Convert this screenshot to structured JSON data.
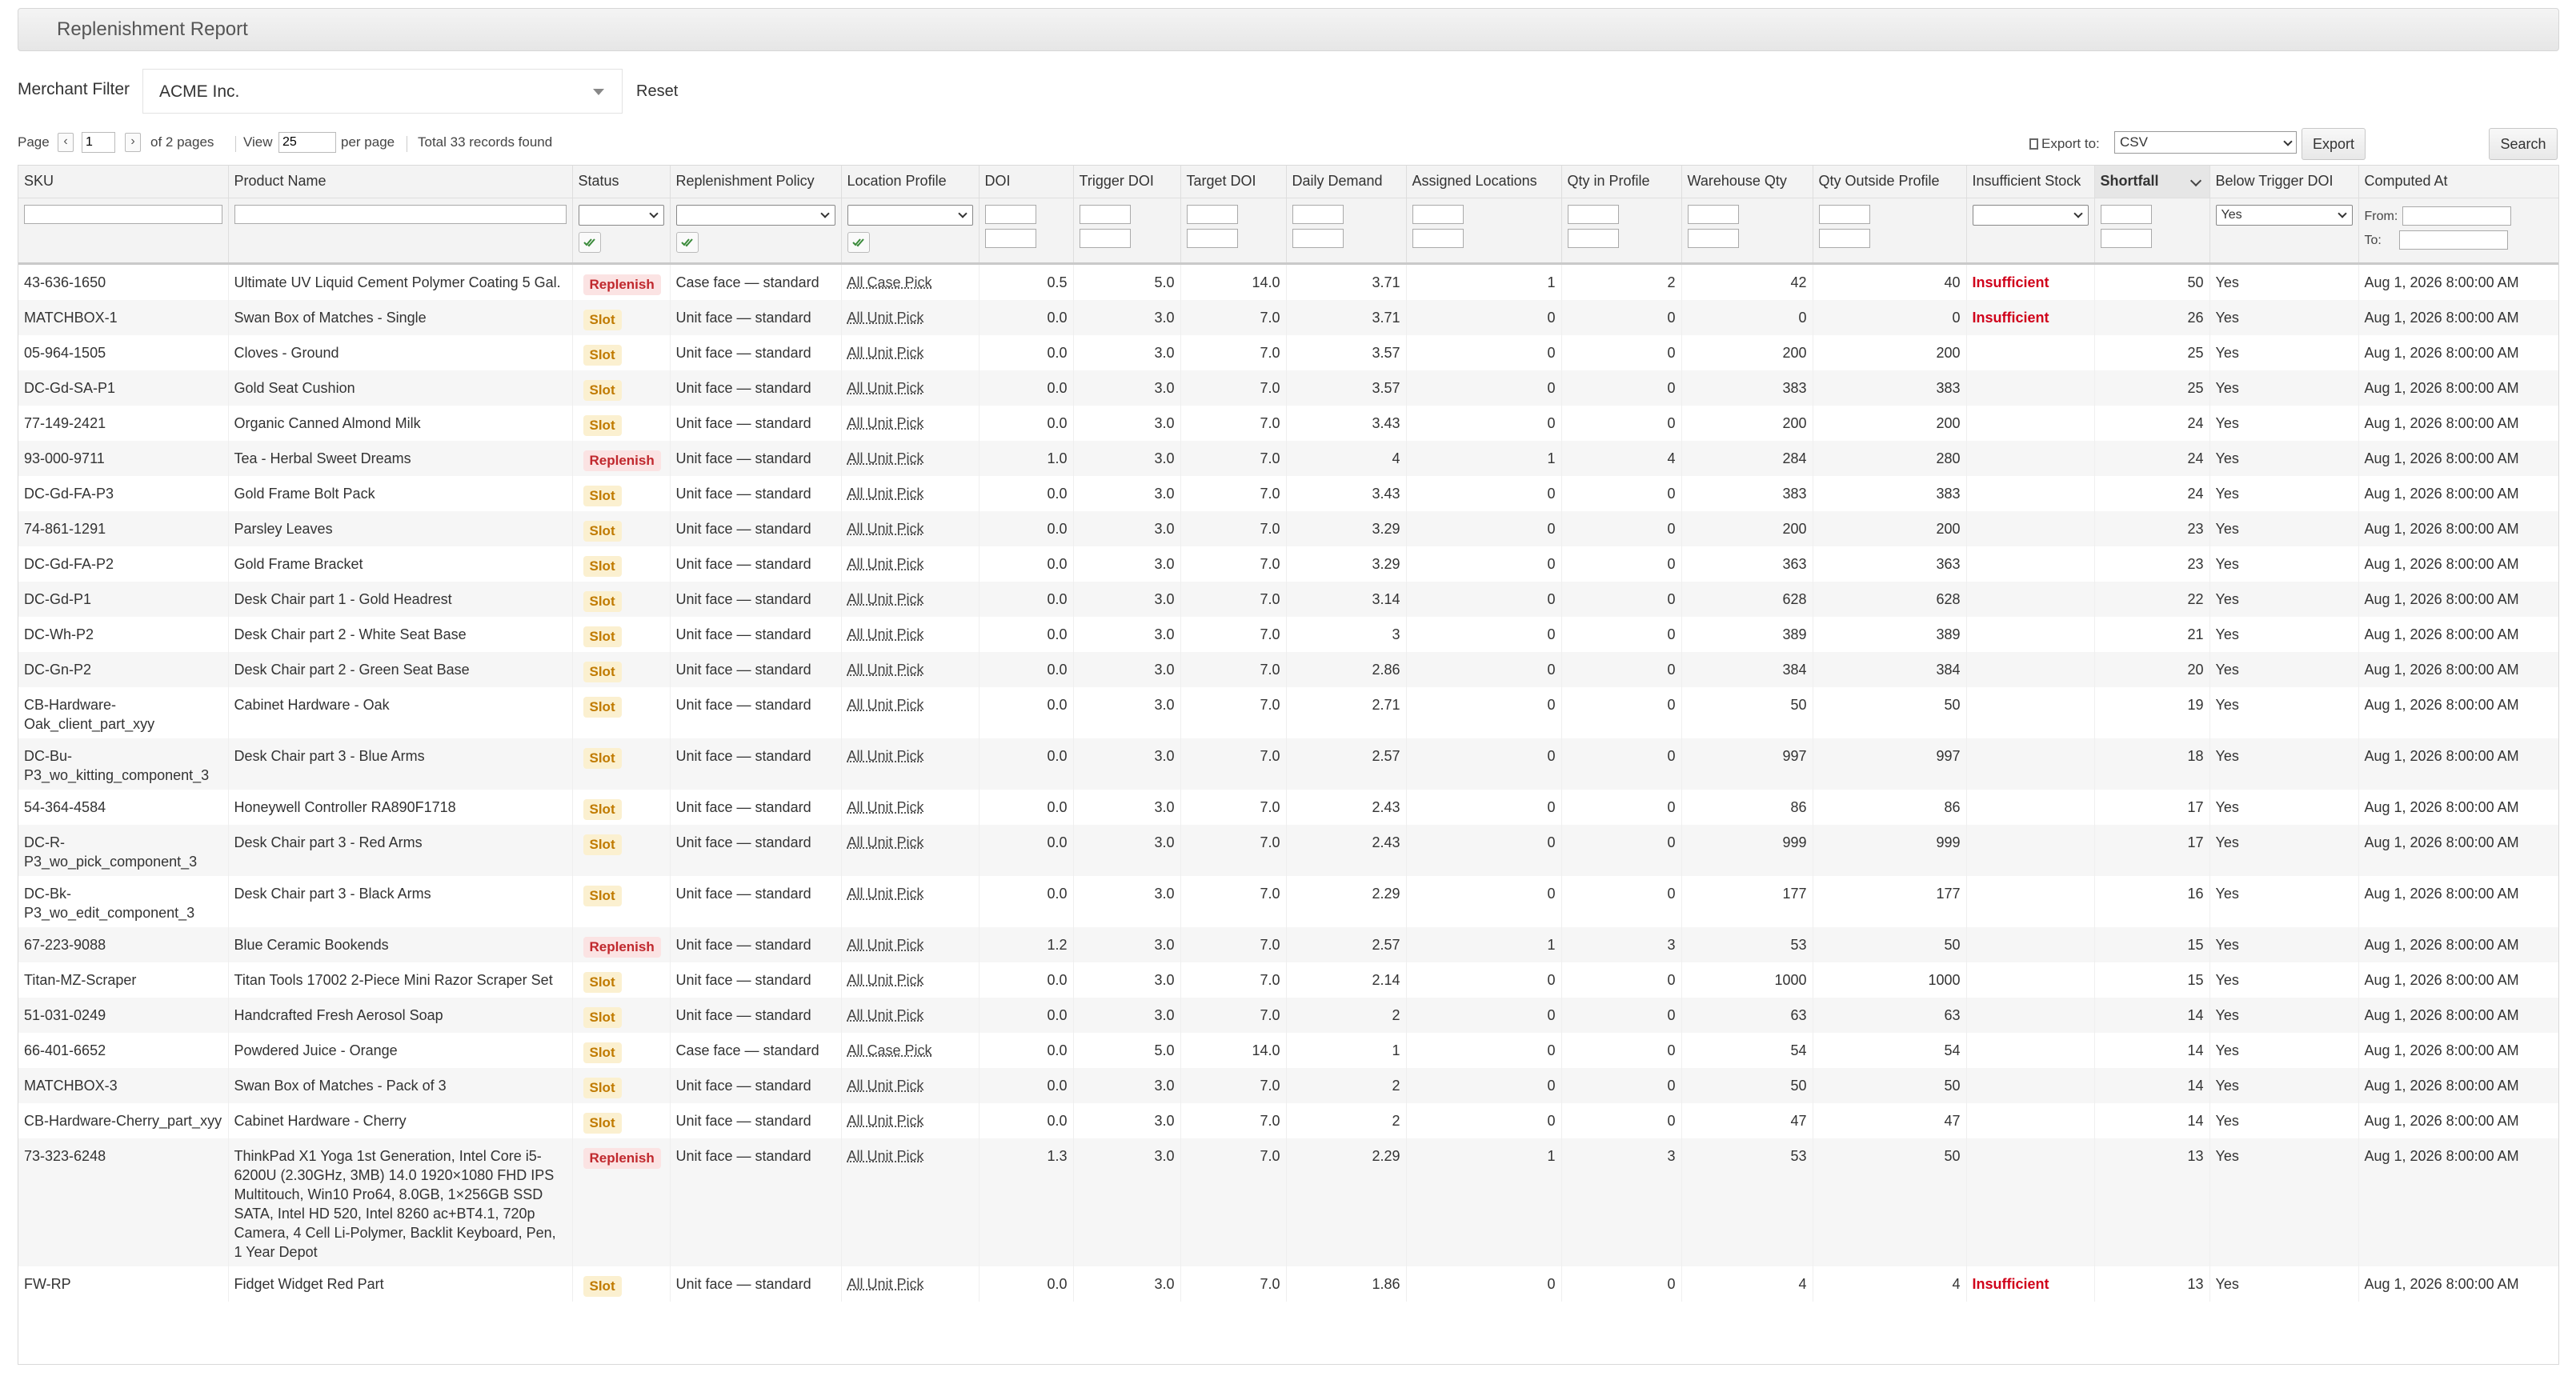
{
  "header": {
    "title": "Replenishment Report"
  },
  "merchant": {
    "label": "Merchant Filter",
    "value": "ACME Inc.",
    "reset": "Reset"
  },
  "pager": {
    "page_label": "Page",
    "page": "1",
    "of_pages": "of 2 pages",
    "view_label": "View",
    "per_page": "25",
    "per_page_label": "per page",
    "total": "Total 33 records found"
  },
  "export": {
    "label": "Export to:",
    "format": "CSV",
    "button": "Export"
  },
  "search_button": "Search",
  "columns": [
    "SKU",
    "Product Name",
    "Status",
    "Replenishment Policy",
    "Location Profile",
    "DOI",
    "Trigger DOI",
    "Target DOI",
    "Daily Demand",
    "Assigned Locations",
    "Qty in Profile",
    "Warehouse Qty",
    "Qty Outside Profile",
    "Insufficient Stock",
    "Shortfall",
    "Below Trigger DOI",
    "Computed At"
  ],
  "filters": {
    "below_trigger": "Yes",
    "from_label": "From:",
    "to_label": "To:"
  },
  "rows": [
    {
      "sku": "43-636-1650",
      "name": "Ultimate UV Liquid Cement Polymer Coating 5 Gal.",
      "status": "Replenish",
      "policy": "Case face — standard",
      "location": "All Case Pick",
      "doi": "0.5",
      "trigger": "5.0",
      "target": "14.0",
      "demand": "3.71",
      "assigned": "1",
      "in_profile": "2",
      "warehouse": "42",
      "outside": "40",
      "insufficient": "Insufficient",
      "shortfall": "50",
      "below": "Yes",
      "computed": "Aug 1, 2026 8:00:00 AM"
    },
    {
      "sku": "MATCHBOX-1",
      "name": "Swan Box of Matches - Single",
      "status": "Slot",
      "policy": "Unit face — standard",
      "location": "All Unit Pick",
      "doi": "0.0",
      "trigger": "3.0",
      "target": "7.0",
      "demand": "3.71",
      "assigned": "0",
      "in_profile": "0",
      "warehouse": "0",
      "outside": "0",
      "insufficient": "Insufficient",
      "shortfall": "26",
      "below": "Yes",
      "computed": "Aug 1, 2026 8:00:00 AM"
    },
    {
      "sku": "05-964-1505",
      "name": "Cloves - Ground",
      "status": "Slot",
      "policy": "Unit face — standard",
      "location": "All Unit Pick",
      "doi": "0.0",
      "trigger": "3.0",
      "target": "7.0",
      "demand": "3.57",
      "assigned": "0",
      "in_profile": "0",
      "warehouse": "200",
      "outside": "200",
      "insufficient": "",
      "shortfall": "25",
      "below": "Yes",
      "computed": "Aug 1, 2026 8:00:00 AM"
    },
    {
      "sku": "DC-Gd-SA-P1",
      "name": "Gold Seat Cushion",
      "status": "Slot",
      "policy": "Unit face — standard",
      "location": "All Unit Pick",
      "doi": "0.0",
      "trigger": "3.0",
      "target": "7.0",
      "demand": "3.57",
      "assigned": "0",
      "in_profile": "0",
      "warehouse": "383",
      "outside": "383",
      "insufficient": "",
      "shortfall": "25",
      "below": "Yes",
      "computed": "Aug 1, 2026 8:00:00 AM"
    },
    {
      "sku": "77-149-2421",
      "name": "Organic Canned Almond Milk",
      "status": "Slot",
      "policy": "Unit face — standard",
      "location": "All Unit Pick",
      "doi": "0.0",
      "trigger": "3.0",
      "target": "7.0",
      "demand": "3.43",
      "assigned": "0",
      "in_profile": "0",
      "warehouse": "200",
      "outside": "200",
      "insufficient": "",
      "shortfall": "24",
      "below": "Yes",
      "computed": "Aug 1, 2026 8:00:00 AM"
    },
    {
      "sku": "93-000-9711",
      "name": "Tea - Herbal Sweet Dreams",
      "status": "Replenish",
      "policy": "Unit face — standard",
      "location": "All Unit Pick",
      "doi": "1.0",
      "trigger": "3.0",
      "target": "7.0",
      "demand": "4",
      "assigned": "1",
      "in_profile": "4",
      "warehouse": "284",
      "outside": "280",
      "insufficient": "",
      "shortfall": "24",
      "below": "Yes",
      "computed": "Aug 1, 2026 8:00:00 AM"
    },
    {
      "sku": "DC-Gd-FA-P3",
      "name": "Gold Frame Bolt Pack",
      "status": "Slot",
      "policy": "Unit face — standard",
      "location": "All Unit Pick",
      "doi": "0.0",
      "trigger": "3.0",
      "target": "7.0",
      "demand": "3.43",
      "assigned": "0",
      "in_profile": "0",
      "warehouse": "383",
      "outside": "383",
      "insufficient": "",
      "shortfall": "24",
      "below": "Yes",
      "computed": "Aug 1, 2026 8:00:00 AM"
    },
    {
      "sku": "74-861-1291",
      "name": "Parsley Leaves",
      "status": "Slot",
      "policy": "Unit face — standard",
      "location": "All Unit Pick",
      "doi": "0.0",
      "trigger": "3.0",
      "target": "7.0",
      "demand": "3.29",
      "assigned": "0",
      "in_profile": "0",
      "warehouse": "200",
      "outside": "200",
      "insufficient": "",
      "shortfall": "23",
      "below": "Yes",
      "computed": "Aug 1, 2026 8:00:00 AM"
    },
    {
      "sku": "DC-Gd-FA-P2",
      "name": "Gold Frame Bracket",
      "status": "Slot",
      "policy": "Unit face — standard",
      "location": "All Unit Pick",
      "doi": "0.0",
      "trigger": "3.0",
      "target": "7.0",
      "demand": "3.29",
      "assigned": "0",
      "in_profile": "0",
      "warehouse": "363",
      "outside": "363",
      "insufficient": "",
      "shortfall": "23",
      "below": "Yes",
      "computed": "Aug 1, 2026 8:00:00 AM"
    },
    {
      "sku": "DC-Gd-P1",
      "name": "Desk Chair part 1 - Gold Headrest",
      "status": "Slot",
      "policy": "Unit face — standard",
      "location": "All Unit Pick",
      "doi": "0.0",
      "trigger": "3.0",
      "target": "7.0",
      "demand": "3.14",
      "assigned": "0",
      "in_profile": "0",
      "warehouse": "628",
      "outside": "628",
      "insufficient": "",
      "shortfall": "22",
      "below": "Yes",
      "computed": "Aug 1, 2026 8:00:00 AM"
    },
    {
      "sku": "DC-Wh-P2",
      "name": "Desk Chair part 2 - White Seat Base",
      "status": "Slot",
      "policy": "Unit face — standard",
      "location": "All Unit Pick",
      "doi": "0.0",
      "trigger": "3.0",
      "target": "7.0",
      "demand": "3",
      "assigned": "0",
      "in_profile": "0",
      "warehouse": "389",
      "outside": "389",
      "insufficient": "",
      "shortfall": "21",
      "below": "Yes",
      "computed": "Aug 1, 2026 8:00:00 AM"
    },
    {
      "sku": "DC-Gn-P2",
      "name": "Desk Chair part 2 - Green Seat Base",
      "status": "Slot",
      "policy": "Unit face — standard",
      "location": "All Unit Pick",
      "doi": "0.0",
      "trigger": "3.0",
      "target": "7.0",
      "demand": "2.86",
      "assigned": "0",
      "in_profile": "0",
      "warehouse": "384",
      "outside": "384",
      "insufficient": "",
      "shortfall": "20",
      "below": "Yes",
      "computed": "Aug 1, 2026 8:00:00 AM"
    },
    {
      "sku": "CB-Hardware-Oak_client_part_xyy",
      "name": "Cabinet Hardware - Oak",
      "status": "Slot",
      "policy": "Unit face — standard",
      "location": "All Unit Pick",
      "doi": "0.0",
      "trigger": "3.0",
      "target": "7.0",
      "demand": "2.71",
      "assigned": "0",
      "in_profile": "0",
      "warehouse": "50",
      "outside": "50",
      "insufficient": "",
      "shortfall": "19",
      "below": "Yes",
      "computed": "Aug 1, 2026 8:00:00 AM"
    },
    {
      "sku": "DC-Bu-P3_wo_kitting_component_3",
      "name": "Desk Chair part 3 - Blue Arms",
      "status": "Slot",
      "policy": "Unit face — standard",
      "location": "All Unit Pick",
      "doi": "0.0",
      "trigger": "3.0",
      "target": "7.0",
      "demand": "2.57",
      "assigned": "0",
      "in_profile": "0",
      "warehouse": "997",
      "outside": "997",
      "insufficient": "",
      "shortfall": "18",
      "below": "Yes",
      "computed": "Aug 1, 2026 8:00:00 AM"
    },
    {
      "sku": "54-364-4584",
      "name": "Honeywell Controller RA890F1718",
      "status": "Slot",
      "policy": "Unit face — standard",
      "location": "All Unit Pick",
      "doi": "0.0",
      "trigger": "3.0",
      "target": "7.0",
      "demand": "2.43",
      "assigned": "0",
      "in_profile": "0",
      "warehouse": "86",
      "outside": "86",
      "insufficient": "",
      "shortfall": "17",
      "below": "Yes",
      "computed": "Aug 1, 2026 8:00:00 AM"
    },
    {
      "sku": "DC-R-P3_wo_pick_component_3",
      "name": "Desk Chair part 3 - Red Arms",
      "status": "Slot",
      "policy": "Unit face — standard",
      "location": "All Unit Pick",
      "doi": "0.0",
      "trigger": "3.0",
      "target": "7.0",
      "demand": "2.43",
      "assigned": "0",
      "in_profile": "0",
      "warehouse": "999",
      "outside": "999",
      "insufficient": "",
      "shortfall": "17",
      "below": "Yes",
      "computed": "Aug 1, 2026 8:00:00 AM"
    },
    {
      "sku": "DC-Bk-P3_wo_edit_component_3",
      "name": "Desk Chair part 3 - Black Arms",
      "status": "Slot",
      "policy": "Unit face — standard",
      "location": "All Unit Pick",
      "doi": "0.0",
      "trigger": "3.0",
      "target": "7.0",
      "demand": "2.29",
      "assigned": "0",
      "in_profile": "0",
      "warehouse": "177",
      "outside": "177",
      "insufficient": "",
      "shortfall": "16",
      "below": "Yes",
      "computed": "Aug 1, 2026 8:00:00 AM"
    },
    {
      "sku": "67-223-9088",
      "name": "Blue Ceramic Bookends",
      "status": "Replenish",
      "policy": "Unit face — standard",
      "location": "All Unit Pick",
      "doi": "1.2",
      "trigger": "3.0",
      "target": "7.0",
      "demand": "2.57",
      "assigned": "1",
      "in_profile": "3",
      "warehouse": "53",
      "outside": "50",
      "insufficient": "",
      "shortfall": "15",
      "below": "Yes",
      "computed": "Aug 1, 2026 8:00:00 AM"
    },
    {
      "sku": "Titan-MZ-Scraper",
      "name": "Titan Tools 17002 2-Piece Mini Razor Scraper Set",
      "status": "Slot",
      "policy": "Unit face — standard",
      "location": "All Unit Pick",
      "doi": "0.0",
      "trigger": "3.0",
      "target": "7.0",
      "demand": "2.14",
      "assigned": "0",
      "in_profile": "0",
      "warehouse": "1000",
      "outside": "1000",
      "insufficient": "",
      "shortfall": "15",
      "below": "Yes",
      "computed": "Aug 1, 2026 8:00:00 AM"
    },
    {
      "sku": "51-031-0249",
      "name": "Handcrafted Fresh Aerosol Soap",
      "status": "Slot",
      "policy": "Unit face — standard",
      "location": "All Unit Pick",
      "doi": "0.0",
      "trigger": "3.0",
      "target": "7.0",
      "demand": "2",
      "assigned": "0",
      "in_profile": "0",
      "warehouse": "63",
      "outside": "63",
      "insufficient": "",
      "shortfall": "14",
      "below": "Yes",
      "computed": "Aug 1, 2026 8:00:00 AM"
    },
    {
      "sku": "66-401-6652",
      "name": "Powdered Juice - Orange",
      "status": "Slot",
      "policy": "Case face — standard",
      "location": "All Case Pick",
      "doi": "0.0",
      "trigger": "5.0",
      "target": "14.0",
      "demand": "1",
      "assigned": "0",
      "in_profile": "0",
      "warehouse": "54",
      "outside": "54",
      "insufficient": "",
      "shortfall": "14",
      "below": "Yes",
      "computed": "Aug 1, 2026 8:00:00 AM"
    },
    {
      "sku": "MATCHBOX-3",
      "name": "Swan Box of Matches - Pack of 3",
      "status": "Slot",
      "policy": "Unit face — standard",
      "location": "All Unit Pick",
      "doi": "0.0",
      "trigger": "3.0",
      "target": "7.0",
      "demand": "2",
      "assigned": "0",
      "in_profile": "0",
      "warehouse": "50",
      "outside": "50",
      "insufficient": "",
      "shortfall": "14",
      "below": "Yes",
      "computed": "Aug 1, 2026 8:00:00 AM"
    },
    {
      "sku": "CB-Hardware-Cherry_part_xyy",
      "name": "Cabinet Hardware - Cherry",
      "status": "Slot",
      "policy": "Unit face — standard",
      "location": "All Unit Pick",
      "doi": "0.0",
      "trigger": "3.0",
      "target": "7.0",
      "demand": "2",
      "assigned": "0",
      "in_profile": "0",
      "warehouse": "47",
      "outside": "47",
      "insufficient": "",
      "shortfall": "14",
      "below": "Yes",
      "computed": "Aug 1, 2026 8:00:00 AM"
    },
    {
      "sku": "73-323-6248",
      "name": "ThinkPad X1 Yoga 1st Generation, Intel Core i5-6200U (2.30GHz, 3MB) 14.0 1920×1080 FHD IPS Multitouch, Win10 Pro64, 8.0GB, 1×256GB SSD SATA, Intel HD 520, Intel 8260 ac+BT4.1, 720p Camera, 4 Cell Li-Polymer, Backlit Keyboard, Pen, 1 Year Depot",
      "status": "Replenish",
      "policy": "Unit face — standard",
      "location": "All Unit Pick",
      "doi": "1.3",
      "trigger": "3.0",
      "target": "7.0",
      "demand": "2.29",
      "assigned": "1",
      "in_profile": "3",
      "warehouse": "53",
      "outside": "50",
      "insufficient": "",
      "shortfall": "13",
      "below": "Yes",
      "computed": "Aug 1, 2026 8:00:00 AM"
    },
    {
      "sku": "FW-RP",
      "name": "Fidget Widget Red Part",
      "status": "Slot",
      "policy": "Unit face — standard",
      "location": "All Unit Pick",
      "doi": "0.0",
      "trigger": "3.0",
      "target": "7.0",
      "demand": "1.86",
      "assigned": "0",
      "in_profile": "0",
      "warehouse": "4",
      "outside": "4",
      "insufficient": "Insufficient",
      "shortfall": "13",
      "below": "Yes",
      "computed": "Aug 1, 2026 8:00:00 AM"
    }
  ]
}
